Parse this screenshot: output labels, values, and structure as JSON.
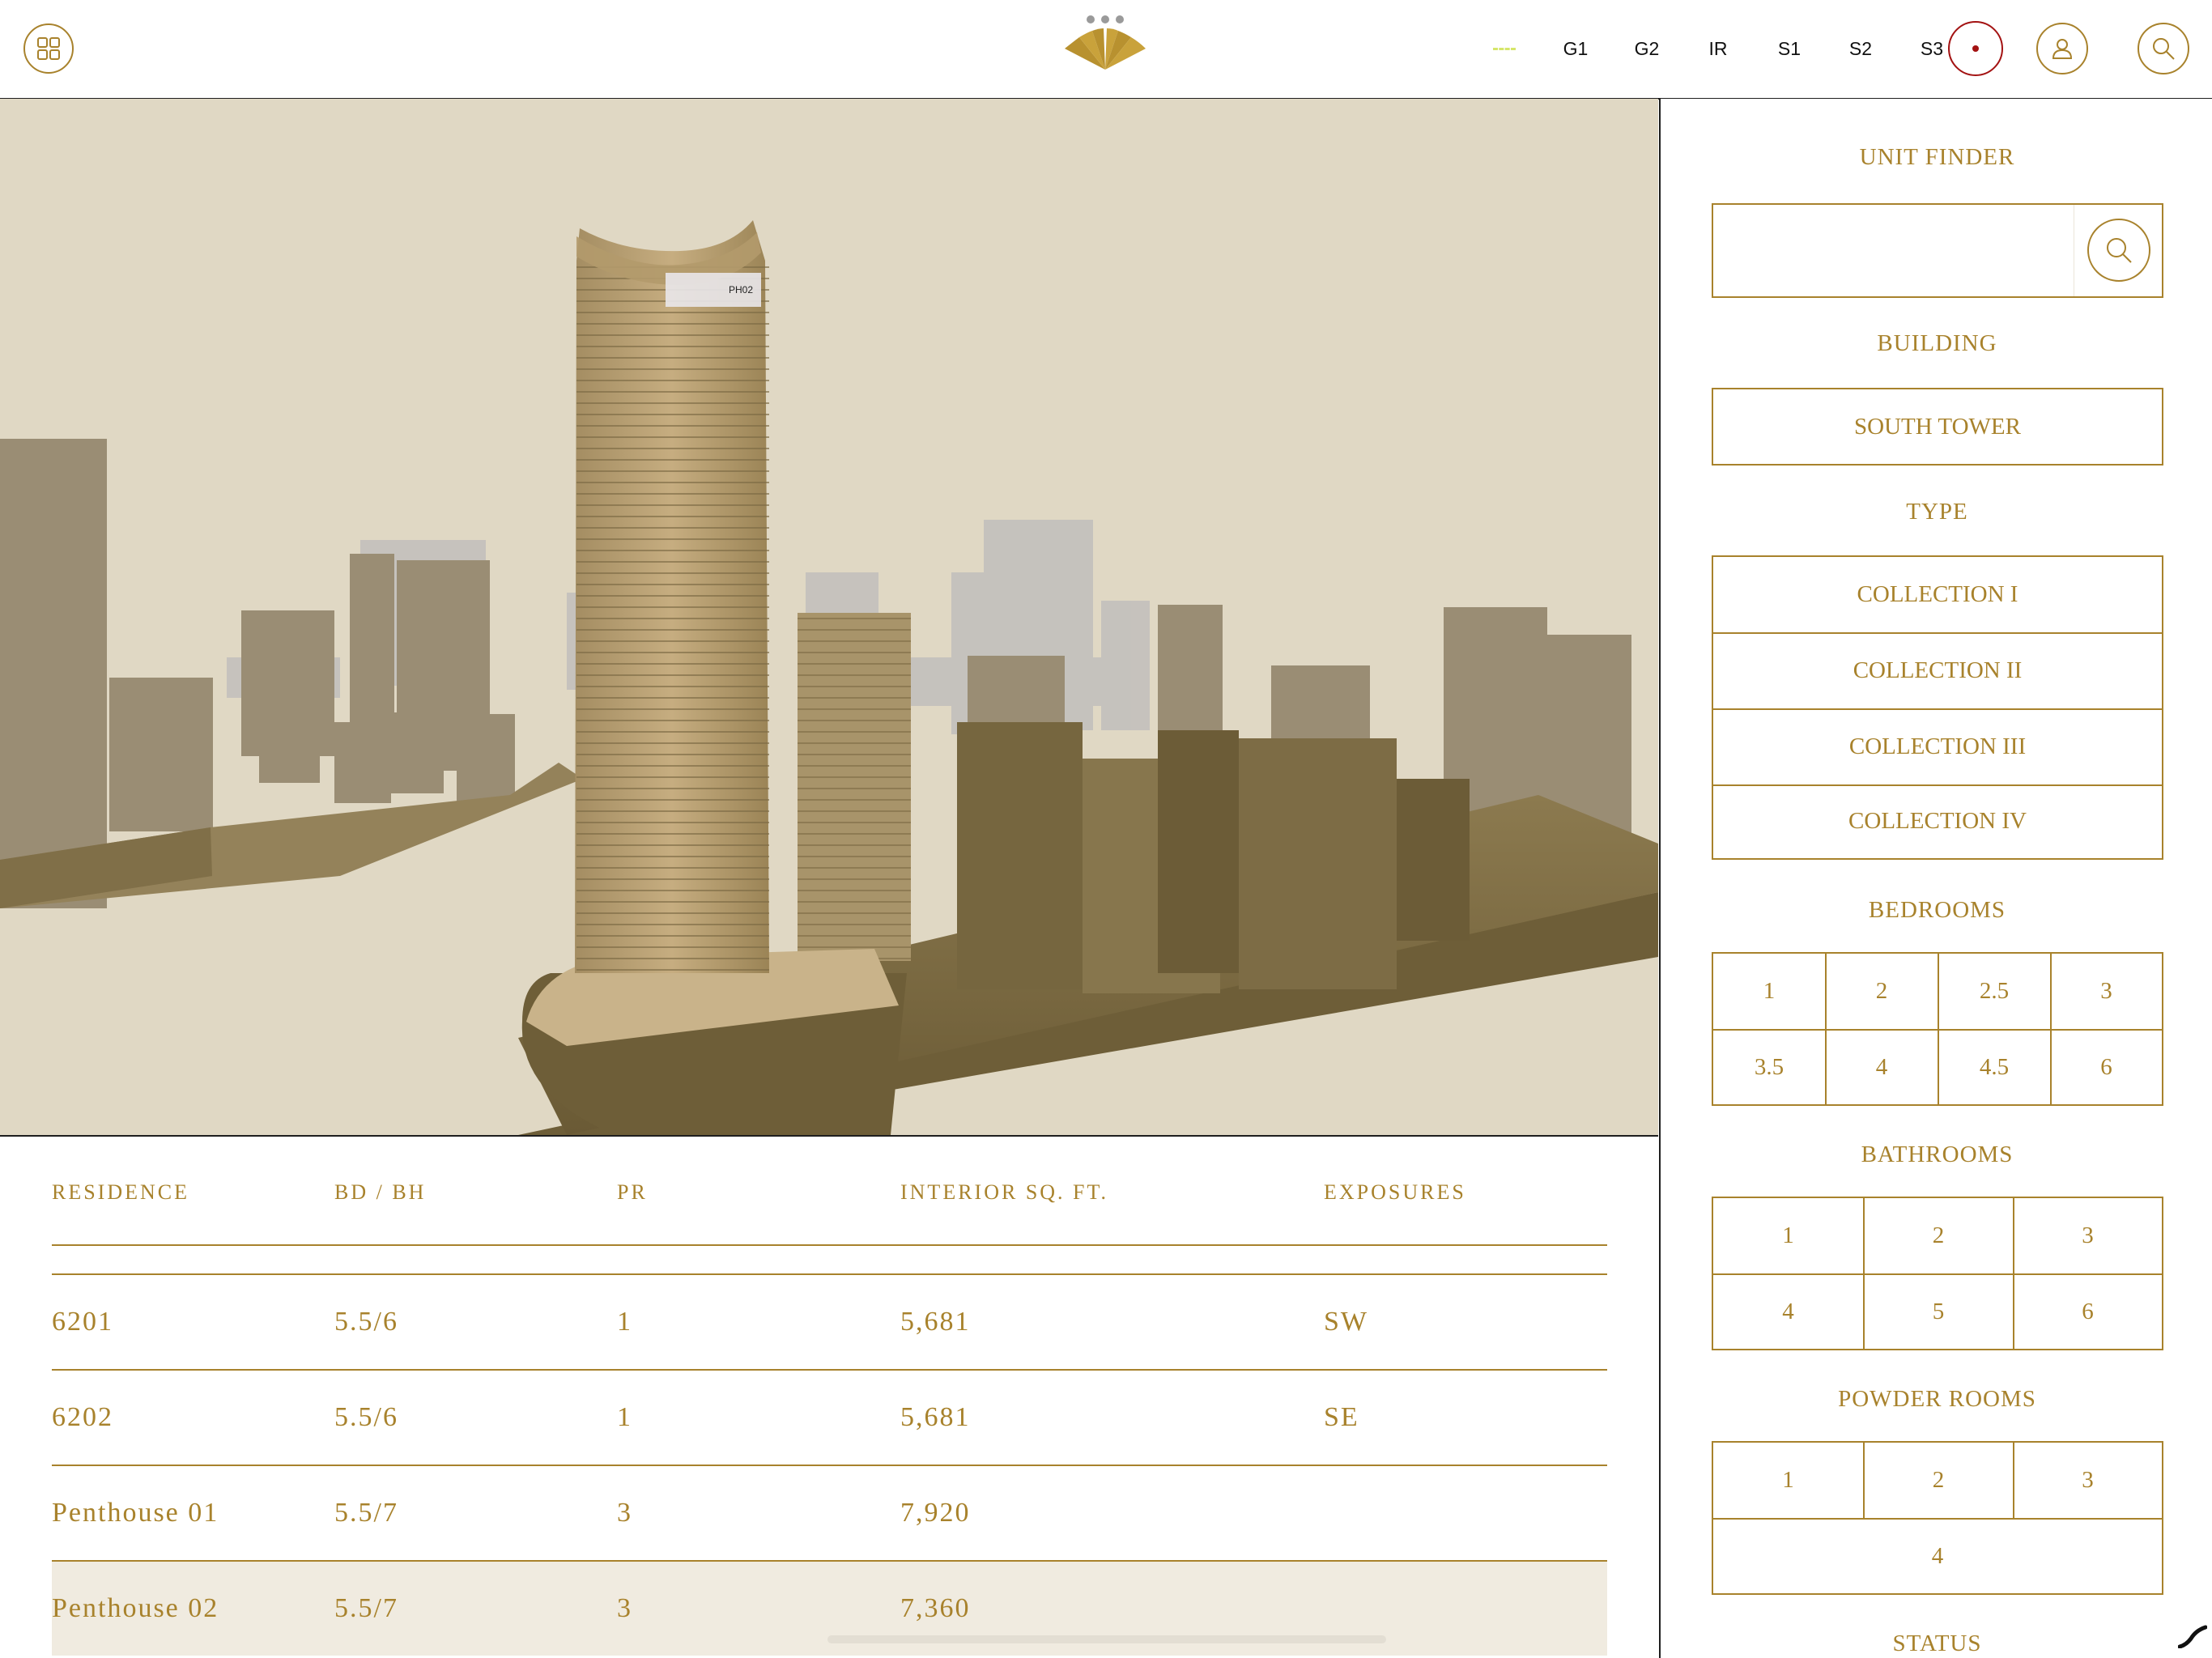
{
  "header": {
    "menu_icon": "grid-menu-icon",
    "logo_icon": "fan-logo-icon",
    "floors": [
      "G1",
      "G2",
      "IR",
      "S1",
      "S2",
      "S3"
    ],
    "record_icon": "record-icon",
    "user_icon": "user-icon",
    "search_icon": "search-icon"
  },
  "viewport": {
    "tag_label": "PH02"
  },
  "table": {
    "headers": [
      "RESIDENCE",
      "BD / BH",
      "PR",
      "INTERIOR SQ. FT.",
      "EXPOSURES"
    ],
    "rows": [
      {
        "residence": "6201",
        "bd_bh": "5.5/6",
        "pr": "1",
        "sqft": "5,681",
        "exposure": "SW"
      },
      {
        "residence": "6202",
        "bd_bh": "5.5/6",
        "pr": "1",
        "sqft": "5,681",
        "exposure": "SE"
      },
      {
        "residence": "Penthouse 01",
        "bd_bh": "5.5/7",
        "pr": "3",
        "sqft": "7,920",
        "exposure": ""
      },
      {
        "residence": "Penthouse 02",
        "bd_bh": "5.5/7",
        "pr": "3",
        "sqft": "7,360",
        "exposure": ""
      }
    ],
    "selected_row": "Penthouse 02"
  },
  "sidebar": {
    "unit_finder": {
      "title": "UNIT FINDER",
      "value": "",
      "search_icon": "search-icon"
    },
    "building": {
      "title": "BUILDING",
      "options": [
        "SOUTH TOWER"
      ]
    },
    "type": {
      "title": "TYPE",
      "options": [
        "COLLECTION I",
        "COLLECTION II",
        "COLLECTION III",
        "COLLECTION IV"
      ]
    },
    "bedrooms": {
      "title": "BEDROOMS",
      "options": [
        "1",
        "2",
        "2.5",
        "3",
        "3.5",
        "4",
        "4.5",
        "6"
      ]
    },
    "bathrooms": {
      "title": "BATHROOMS",
      "options": [
        "1",
        "2",
        "3",
        "4",
        "5",
        "6"
      ]
    },
    "powder_rooms": {
      "title": "POWDER ROOMS",
      "options": [
        "1",
        "2",
        "3",
        "4"
      ]
    },
    "status": {
      "title": "STATUS"
    }
  },
  "colors": {
    "accent": "#a8822c",
    "record": "#a31212",
    "selected_row": "#f0ebe0",
    "scene_background": "#e0d8c4"
  }
}
